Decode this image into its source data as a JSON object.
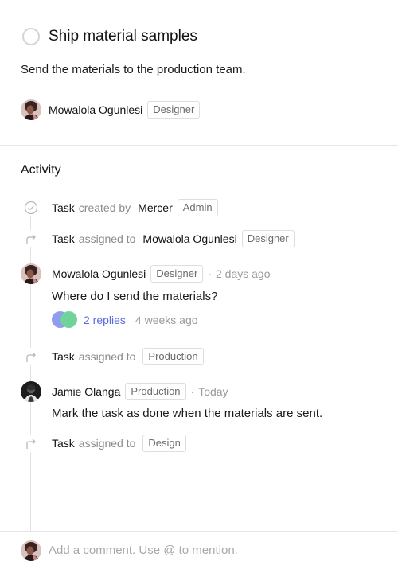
{
  "task": {
    "title": "Ship material samples",
    "description": "Send the materials to the production team.",
    "assignee": {
      "name": "Mowalola Ogunlesi",
      "role": "Designer"
    }
  },
  "activity": {
    "title": "Activity",
    "events": [
      {
        "type": "created",
        "icon": "check-circle-icon",
        "subject": "Task",
        "verb": "created by",
        "actor": "Mercer",
        "badge": "Admin"
      },
      {
        "type": "assigned",
        "icon": "arrow-turn-icon",
        "subject": "Task",
        "verb": "assigned to",
        "actor": "Mowalola Ogunlesi",
        "badge": "Designer"
      },
      {
        "type": "comment",
        "author": "Mowalola Ogunlesi",
        "badge": "Designer",
        "time": "2 days ago",
        "body": "Where do I send the materials?",
        "replies_label": "2 replies",
        "replies_time": "4 weeks ago"
      },
      {
        "type": "assigned",
        "icon": "arrow-turn-icon",
        "subject": "Task",
        "verb": "assigned to",
        "badge": "Production"
      },
      {
        "type": "comment",
        "author": "Jamie Olanga",
        "badge": "Production",
        "time": "Today",
        "body": "Mark the task as done when the materials are sent."
      },
      {
        "type": "assigned",
        "icon": "arrow-turn-icon",
        "subject": "Task",
        "verb": "assigned to",
        "badge": "Design"
      }
    ]
  },
  "composer": {
    "placeholder": "Add a comment. Use @ to mention."
  },
  "separator": "·",
  "colors": {
    "link": "#5a6be0",
    "reply_avatar_1": "#8f9cf0",
    "reply_avatar_2": "#6fd39b"
  }
}
